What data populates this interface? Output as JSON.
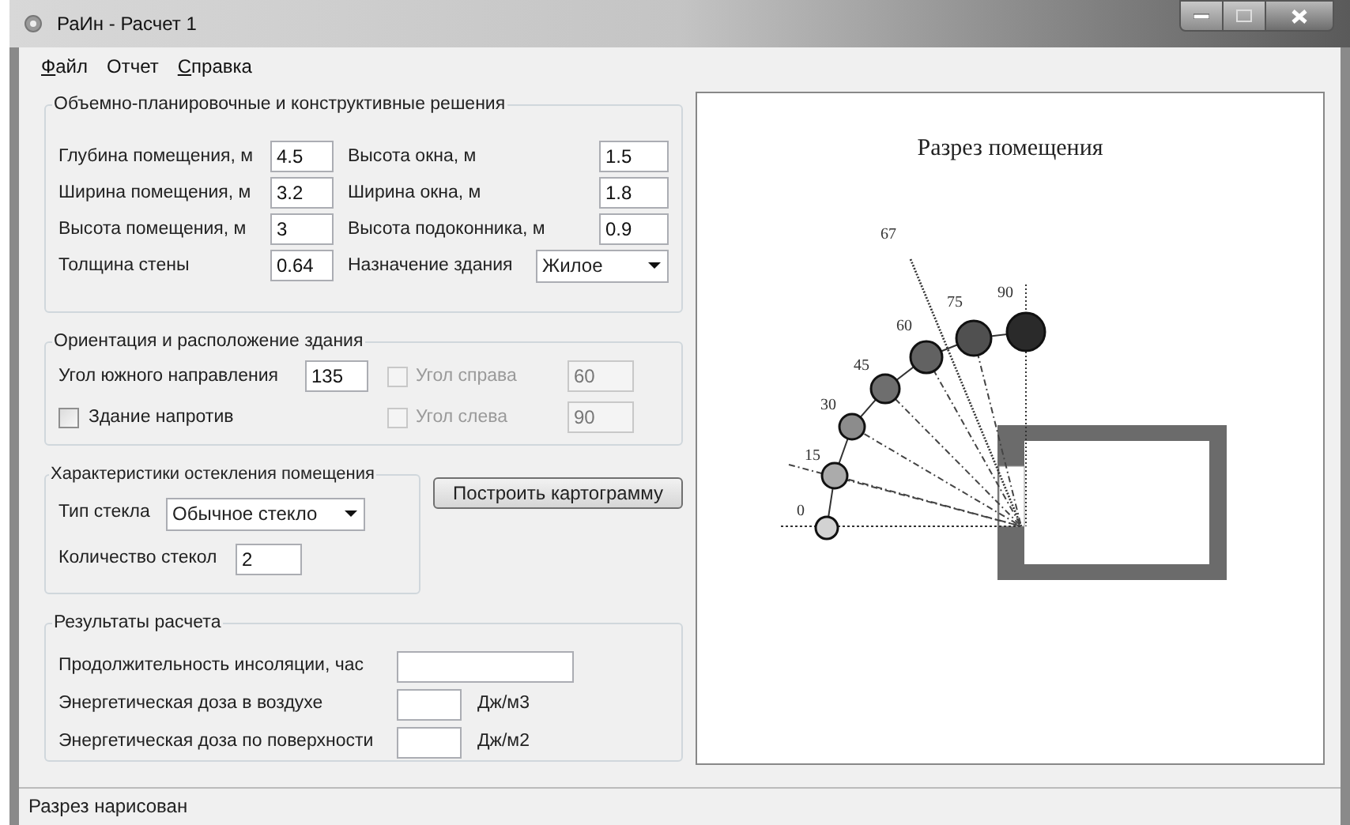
{
  "window": {
    "title": "РаИн - Расчет 1"
  },
  "menu": [
    {
      "label": "Файл",
      "mnemonic": true
    },
    {
      "label": "Отчет",
      "mnemonic": false
    },
    {
      "label": "Справка",
      "mnemonic": true
    }
  ],
  "planning": {
    "title": "Объемно-планировочные и конструктивные решения",
    "rows": [
      {
        "left": {
          "label": "Глубина помещения, м",
          "value": "4.5"
        },
        "right": {
          "label": "Высота окна, м",
          "kind": "input",
          "value": "1.5"
        }
      },
      {
        "left": {
          "label": "Ширина помещения, м",
          "value": "3.2"
        },
        "right": {
          "label": "Ширина окна, м",
          "kind": "input",
          "value": "1.8"
        }
      },
      {
        "left": {
          "label": "Высота помещения, м",
          "value": "3"
        },
        "right": {
          "label": "Высота подоконника, м",
          "kind": "input",
          "value": "0.9"
        }
      },
      {
        "left": {
          "label": "Толщина стены",
          "value": "0.64"
        },
        "right": {
          "label": "Назначение здания",
          "kind": "dropdown",
          "value": "Жилое"
        }
      }
    ]
  },
  "orientation": {
    "title": "Ориентация и расположение здания",
    "south_angle": {
      "label": "Угол южного направления",
      "value": "135"
    },
    "opposite_building": {
      "label": "Здание напротив",
      "checked": false
    },
    "right_angle": {
      "label": "Угол справа",
      "checked": false,
      "disabled": true,
      "value": "60"
    },
    "left_angle": {
      "label": "Угол слева",
      "checked": false,
      "disabled": true,
      "value": "90"
    }
  },
  "glazing": {
    "title": "Характеристики остекления помещения",
    "glass_type": {
      "label": "Тип стекла",
      "value": "Обычное стекло"
    },
    "glass_count": {
      "label": "Количество стекол",
      "value": "2"
    }
  },
  "build_button": "Построить картограмму",
  "results": {
    "title": "Результаты расчета",
    "rows": [
      {
        "label": "Продолжительность инсоляции, час",
        "kind": "wide"
      },
      {
        "label": "Энергетическая доза в воздухе",
        "kind": "unit",
        "unit": "Дж/м3"
      },
      {
        "label": "Энергетическая доза по поверхности",
        "kind": "unit",
        "unit": "Дж/м2"
      }
    ]
  },
  "section_view": {
    "title": "Разрез помещения",
    "angle_labels": [
      "0",
      "15",
      "30",
      "45",
      "60",
      "67",
      "75",
      "90"
    ]
  },
  "status_bar": "Разрез нарисован"
}
